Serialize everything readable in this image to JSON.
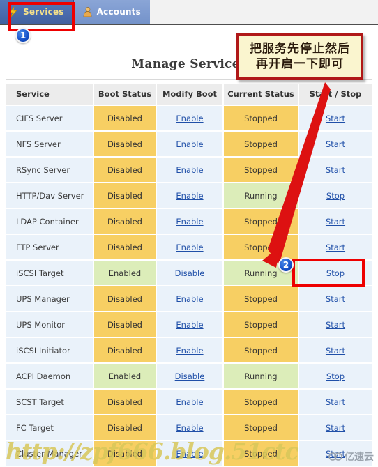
{
  "tabs": [
    {
      "label": "Services",
      "icon": "lightning-bolt-icon",
      "active": true
    },
    {
      "label": "Accounts",
      "icon": "user-icon",
      "active": false
    }
  ],
  "page": {
    "title": "Manage Services"
  },
  "table": {
    "headers": [
      "Service",
      "Boot Status",
      "Modify Boot",
      "Current Status",
      "Start / Stop"
    ],
    "rows": [
      {
        "service": "CIFS Server",
        "boot": "Disabled",
        "modify": "Enable",
        "current": "Stopped",
        "action": "Start"
      },
      {
        "service": "NFS Server",
        "boot": "Disabled",
        "modify": "Enable",
        "current": "Stopped",
        "action": "Start"
      },
      {
        "service": "RSync Server",
        "boot": "Disabled",
        "modify": "Enable",
        "current": "Stopped",
        "action": "Start"
      },
      {
        "service": "HTTP/Dav Server",
        "boot": "Disabled",
        "modify": "Enable",
        "current": "Running",
        "action": "Stop"
      },
      {
        "service": "LDAP Container",
        "boot": "Disabled",
        "modify": "Enable",
        "current": "Stopped",
        "action": "Start"
      },
      {
        "service": "FTP Server",
        "boot": "Disabled",
        "modify": "Enable",
        "current": "Stopped",
        "action": "Start"
      },
      {
        "service": "iSCSI Target",
        "boot": "Enabled",
        "modify": "Disable",
        "current": "Running",
        "action": "Stop"
      },
      {
        "service": "UPS Manager",
        "boot": "Disabled",
        "modify": "Enable",
        "current": "Stopped",
        "action": "Start"
      },
      {
        "service": "UPS Monitor",
        "boot": "Disabled",
        "modify": "Enable",
        "current": "Stopped",
        "action": "Start"
      },
      {
        "service": "iSCSI Initiator",
        "boot": "Disabled",
        "modify": "Enable",
        "current": "Stopped",
        "action": "Start"
      },
      {
        "service": "ACPI Daemon",
        "boot": "Enabled",
        "modify": "Disable",
        "current": "Running",
        "action": "Stop"
      },
      {
        "service": "SCST Target",
        "boot": "Disabled",
        "modify": "Enable",
        "current": "Stopped",
        "action": "Start"
      },
      {
        "service": "FC Target",
        "boot": "Disabled",
        "modify": "Enable",
        "current": "Stopped",
        "action": "Start"
      },
      {
        "service": "Cluster Manager",
        "boot": "Disabled",
        "modify": "Enable",
        "current": "Stopped",
        "action": "Start"
      }
    ]
  },
  "annotations": {
    "callout_line1": "把服务先停止然后",
    "callout_line2": "再开启一下即可",
    "step1": "1",
    "step2": "2"
  },
  "watermark": {
    "url": "http://zpf666.blog.51ctc",
    "logo_text": "亿速云"
  },
  "colors": {
    "accent_red": "#ee0000",
    "callout_bg": "#faf5cf",
    "callout_border": "#b01818",
    "status_off": "#f7cf63",
    "status_on": "#dcedb9",
    "row_bg": "#eaf2fa",
    "link": "#1f4fa8",
    "tab_active": "#4a6cae",
    "tab_inactive": "#7e9bd0"
  }
}
